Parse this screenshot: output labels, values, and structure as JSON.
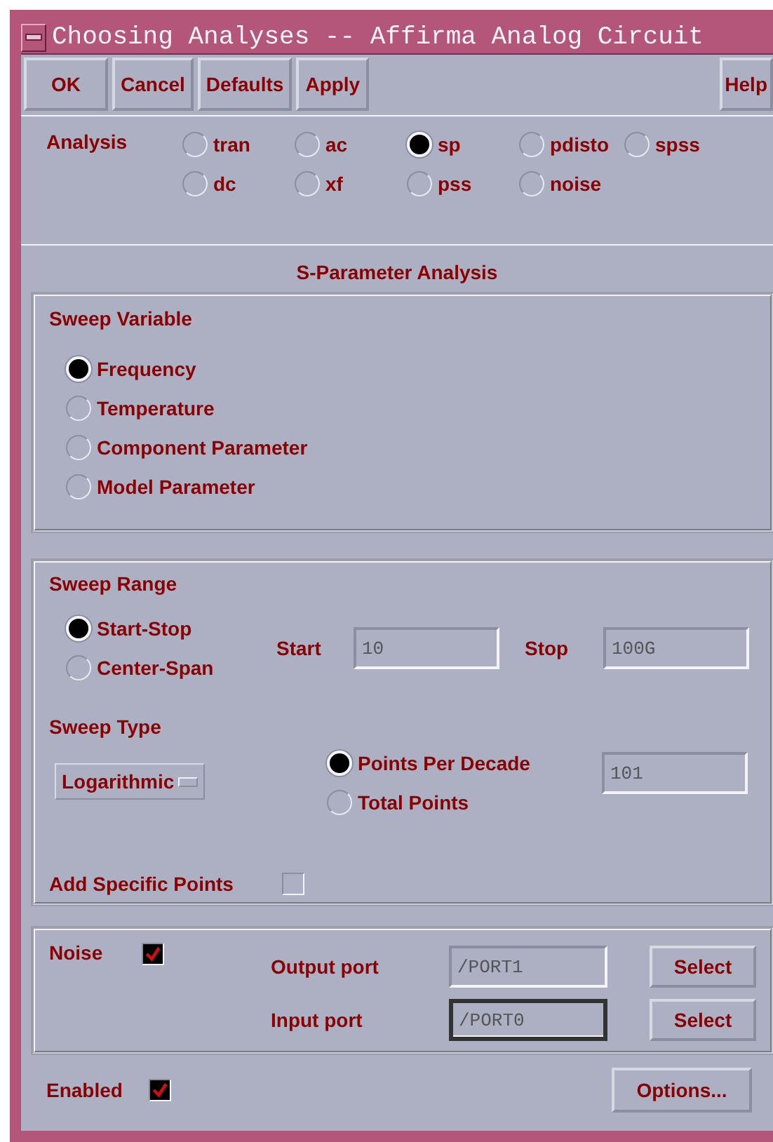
{
  "window": {
    "title": "Choosing Analyses -- Affirma Analog Circuit"
  },
  "buttons": [
    {
      "label": "OK"
    },
    {
      "label": "Cancel"
    },
    {
      "label": "Defaults"
    },
    {
      "label": "Apply"
    }
  ],
  "help_button": "Help",
  "analysis": {
    "label": "Analysis",
    "options": [
      {
        "label": "tran",
        "selected": false
      },
      {
        "label": "ac",
        "selected": false
      },
      {
        "label": "sp",
        "selected": true
      },
      {
        "label": "pdisto",
        "selected": false
      },
      {
        "label": "spss",
        "selected": false
      },
      {
        "label": "dc",
        "selected": false
      },
      {
        "label": "xf",
        "selected": false
      },
      {
        "label": "pss",
        "selected": false
      },
      {
        "label": "noise",
        "selected": false
      }
    ]
  },
  "section_title": "S-Parameter Analysis",
  "sweep_variable": {
    "title": "Sweep Variable",
    "options": [
      {
        "label": "Frequency",
        "selected": true
      },
      {
        "label": "Temperature",
        "selected": false
      },
      {
        "label": "Component Parameter",
        "selected": false
      },
      {
        "label": "Model Parameter",
        "selected": false
      }
    ]
  },
  "sweep_range": {
    "title": "Sweep Range",
    "options": [
      {
        "label": "Start-Stop",
        "selected": true
      },
      {
        "label": "Center-Span",
        "selected": false
      }
    ],
    "start": {
      "label": "Start",
      "value": "10"
    },
    "stop": {
      "label": "Stop",
      "value": "100G"
    }
  },
  "sweep_type": {
    "title": "Sweep Type",
    "value": "Logarithmic",
    "options": [
      {
        "label": "Points Per Decade",
        "selected": true
      },
      {
        "label": "Total Points",
        "selected": false
      }
    ],
    "points": "101"
  },
  "add_specific_points": {
    "label": "Add Specific Points",
    "checked": false
  },
  "noise": {
    "label": "Noise",
    "checked": true,
    "ports": [
      {
        "label": "Output port",
        "value": "/PORT1",
        "button": "Select",
        "focused": false
      },
      {
        "label": "Input port",
        "value": "/PORT0",
        "button": "Select",
        "focused": true
      }
    ]
  },
  "enabled": {
    "label": "Enabled",
    "checked": true
  },
  "options_button": "Options..."
}
